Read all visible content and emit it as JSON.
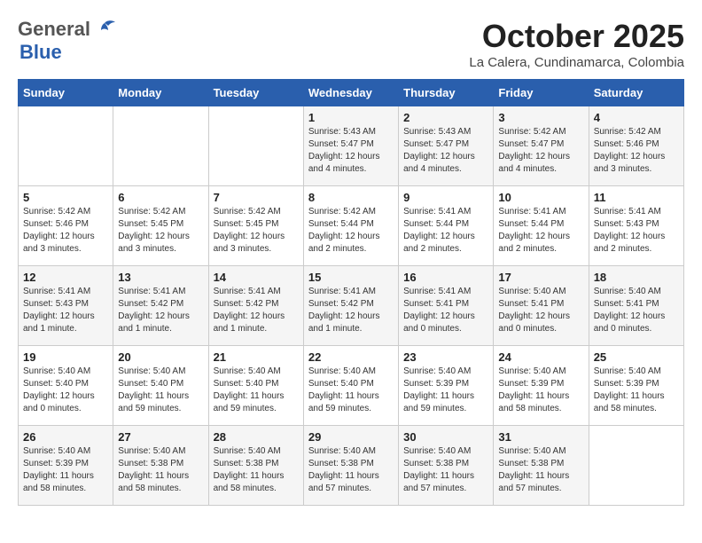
{
  "logo": {
    "general": "General",
    "blue": "Blue"
  },
  "header": {
    "month": "October 2025",
    "location": "La Calera, Cundinamarca, Colombia"
  },
  "weekdays": [
    "Sunday",
    "Monday",
    "Tuesday",
    "Wednesday",
    "Thursday",
    "Friday",
    "Saturday"
  ],
  "weeks": [
    [
      {
        "day": "",
        "info": ""
      },
      {
        "day": "",
        "info": ""
      },
      {
        "day": "",
        "info": ""
      },
      {
        "day": "1",
        "info": "Sunrise: 5:43 AM\nSunset: 5:47 PM\nDaylight: 12 hours\nand 4 minutes."
      },
      {
        "day": "2",
        "info": "Sunrise: 5:43 AM\nSunset: 5:47 PM\nDaylight: 12 hours\nand 4 minutes."
      },
      {
        "day": "3",
        "info": "Sunrise: 5:42 AM\nSunset: 5:47 PM\nDaylight: 12 hours\nand 4 minutes."
      },
      {
        "day": "4",
        "info": "Sunrise: 5:42 AM\nSunset: 5:46 PM\nDaylight: 12 hours\nand 3 minutes."
      }
    ],
    [
      {
        "day": "5",
        "info": "Sunrise: 5:42 AM\nSunset: 5:46 PM\nDaylight: 12 hours\nand 3 minutes."
      },
      {
        "day": "6",
        "info": "Sunrise: 5:42 AM\nSunset: 5:45 PM\nDaylight: 12 hours\nand 3 minutes."
      },
      {
        "day": "7",
        "info": "Sunrise: 5:42 AM\nSunset: 5:45 PM\nDaylight: 12 hours\nand 3 minutes."
      },
      {
        "day": "8",
        "info": "Sunrise: 5:42 AM\nSunset: 5:44 PM\nDaylight: 12 hours\nand 2 minutes."
      },
      {
        "day": "9",
        "info": "Sunrise: 5:41 AM\nSunset: 5:44 PM\nDaylight: 12 hours\nand 2 minutes."
      },
      {
        "day": "10",
        "info": "Sunrise: 5:41 AM\nSunset: 5:44 PM\nDaylight: 12 hours\nand 2 minutes."
      },
      {
        "day": "11",
        "info": "Sunrise: 5:41 AM\nSunset: 5:43 PM\nDaylight: 12 hours\nand 2 minutes."
      }
    ],
    [
      {
        "day": "12",
        "info": "Sunrise: 5:41 AM\nSunset: 5:43 PM\nDaylight: 12 hours\nand 1 minute."
      },
      {
        "day": "13",
        "info": "Sunrise: 5:41 AM\nSunset: 5:42 PM\nDaylight: 12 hours\nand 1 minute."
      },
      {
        "day": "14",
        "info": "Sunrise: 5:41 AM\nSunset: 5:42 PM\nDaylight: 12 hours\nand 1 minute."
      },
      {
        "day": "15",
        "info": "Sunrise: 5:41 AM\nSunset: 5:42 PM\nDaylight: 12 hours\nand 1 minute."
      },
      {
        "day": "16",
        "info": "Sunrise: 5:41 AM\nSunset: 5:41 PM\nDaylight: 12 hours\nand 0 minutes."
      },
      {
        "day": "17",
        "info": "Sunrise: 5:40 AM\nSunset: 5:41 PM\nDaylight: 12 hours\nand 0 minutes."
      },
      {
        "day": "18",
        "info": "Sunrise: 5:40 AM\nSunset: 5:41 PM\nDaylight: 12 hours\nand 0 minutes."
      }
    ],
    [
      {
        "day": "19",
        "info": "Sunrise: 5:40 AM\nSunset: 5:40 PM\nDaylight: 12 hours\nand 0 minutes."
      },
      {
        "day": "20",
        "info": "Sunrise: 5:40 AM\nSunset: 5:40 PM\nDaylight: 11 hours\nand 59 minutes."
      },
      {
        "day": "21",
        "info": "Sunrise: 5:40 AM\nSunset: 5:40 PM\nDaylight: 11 hours\nand 59 minutes."
      },
      {
        "day": "22",
        "info": "Sunrise: 5:40 AM\nSunset: 5:40 PM\nDaylight: 11 hours\nand 59 minutes."
      },
      {
        "day": "23",
        "info": "Sunrise: 5:40 AM\nSunset: 5:39 PM\nDaylight: 11 hours\nand 59 minutes."
      },
      {
        "day": "24",
        "info": "Sunrise: 5:40 AM\nSunset: 5:39 PM\nDaylight: 11 hours\nand 58 minutes."
      },
      {
        "day": "25",
        "info": "Sunrise: 5:40 AM\nSunset: 5:39 PM\nDaylight: 11 hours\nand 58 minutes."
      }
    ],
    [
      {
        "day": "26",
        "info": "Sunrise: 5:40 AM\nSunset: 5:39 PM\nDaylight: 11 hours\nand 58 minutes."
      },
      {
        "day": "27",
        "info": "Sunrise: 5:40 AM\nSunset: 5:38 PM\nDaylight: 11 hours\nand 58 minutes."
      },
      {
        "day": "28",
        "info": "Sunrise: 5:40 AM\nSunset: 5:38 PM\nDaylight: 11 hours\nand 58 minutes."
      },
      {
        "day": "29",
        "info": "Sunrise: 5:40 AM\nSunset: 5:38 PM\nDaylight: 11 hours\nand 57 minutes."
      },
      {
        "day": "30",
        "info": "Sunrise: 5:40 AM\nSunset: 5:38 PM\nDaylight: 11 hours\nand 57 minutes."
      },
      {
        "day": "31",
        "info": "Sunrise: 5:40 AM\nSunset: 5:38 PM\nDaylight: 11 hours\nand 57 minutes."
      },
      {
        "day": "",
        "info": ""
      }
    ]
  ]
}
